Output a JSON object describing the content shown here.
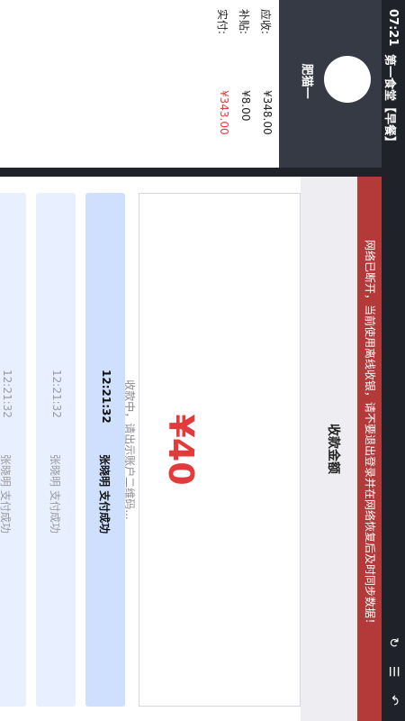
{
  "status_bar": {
    "time": "07:21",
    "title": "第一食堂【早餐】",
    "icons": [
      "refresh-icon",
      "menu-icon",
      "back-icon"
    ]
  },
  "user": {
    "name": "肥猫一"
  },
  "summary": {
    "due_label": "应收:",
    "due_value": "¥348.00",
    "subsidy_label": "补贴:",
    "subsidy_value": "¥8.00",
    "paid_label": "实付:",
    "paid_value": "¥343.00"
  },
  "banner": {
    "text": "网络已断开，当前使用离线收银，请不要退出登录并在网络恢复后及时同步数据！"
  },
  "payment": {
    "title": "收款金额",
    "amount": "¥40",
    "status": "收款中，请出示账户二维码..."
  },
  "records": [
    {
      "time": "12:21:32",
      "text": "张晓明 支付成功"
    },
    {
      "time": "12:21:32",
      "text": "张晓明 支付成功"
    },
    {
      "time": "12:21:32",
      "text": "张晓明 支付成功"
    }
  ],
  "colors": {
    "accent_red": "#e23b3b",
    "banner_red": "#b43a3a",
    "header_dark": "#353a45",
    "record_blue": "#cfe0ff"
  }
}
